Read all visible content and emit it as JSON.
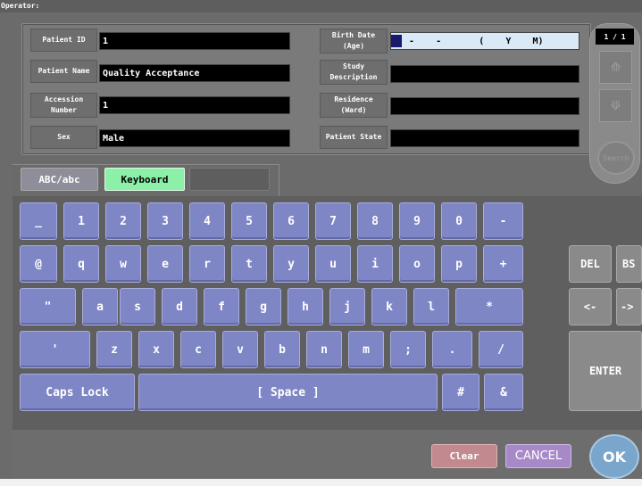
{
  "topbar": {
    "operator_label": "Operator:"
  },
  "patient": {
    "id_label": "Patient ID",
    "id_value": "1",
    "name_label": "Patient Name",
    "name_value": "Quality Acceptance",
    "accession_label_1": "Accession",
    "accession_label_2": "Number",
    "accession_value": "1",
    "sex_label": "Sex",
    "sex_value": "Male",
    "birth_label_1": "Birth Date",
    "birth_label_2": "(Age)",
    "birth_value": "-    -       (    Y    M)",
    "study_label_1": "Study",
    "study_label_2": "Description",
    "study_value": "",
    "residence_label_1": "Residence",
    "residence_label_2": "(Ward)",
    "residence_value": "",
    "state_label": "Patient State",
    "state_value": ""
  },
  "nav": {
    "page": "1 / 1",
    "up_icon": "double-up-triangle-icon",
    "down_icon": "double-down-triangle-icon",
    "search_label": "Search"
  },
  "tabs": {
    "abc": "ABC/abc",
    "keyboard": "Keyboard"
  },
  "keys": {
    "row1": [
      "_",
      "1",
      "2",
      "3",
      "4",
      "5",
      "6",
      "7",
      "8",
      "9",
      "0",
      "-"
    ],
    "row2": [
      "@",
      "q",
      "w",
      "e",
      "r",
      "t",
      "y",
      "u",
      "i",
      "o",
      "p",
      "+"
    ],
    "row3": [
      "\"",
      "a",
      "s",
      "d",
      "f",
      "g",
      "h",
      "j",
      "k",
      "l",
      "*"
    ],
    "row4": [
      "'",
      "z",
      "x",
      "c",
      "v",
      "b",
      "n",
      "m",
      ";",
      ".",
      "/"
    ],
    "row5": [
      "Caps Lock",
      "[ Space ]",
      "#",
      "&"
    ],
    "side": [
      "DEL",
      "BS",
      "<-",
      "->",
      "ENTER"
    ]
  },
  "actions": {
    "clear": "Clear",
    "cancel": "CANCEL",
    "ok": "OK"
  },
  "colors": {
    "key_blue": "#7f86c5",
    "active_tab": "#8cf0a8",
    "clear": "#c28a8e",
    "cancel": "#a889c8",
    "ok": "#7ba6cc"
  }
}
